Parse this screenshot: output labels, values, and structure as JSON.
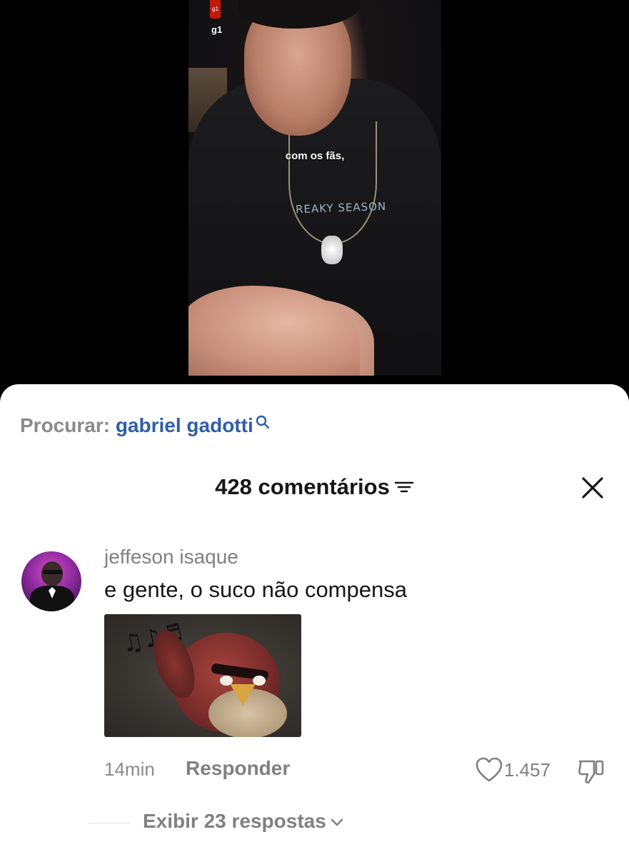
{
  "video": {
    "caption": "com os fãs,",
    "source_badge": "g1",
    "source_label": "g1",
    "shirt_print": "REAKY SEASON"
  },
  "search": {
    "prefix": "Procurar:",
    "term": "gabriel gadotti",
    "icon": "search-icon"
  },
  "comments_header": {
    "title": "428 comentários",
    "filter_icon": "filter-icon",
    "close_icon": "close-icon"
  },
  "comment": {
    "username": "jeffeson isaque",
    "text": "e gente, o suco não compensa",
    "time": "14min",
    "reply_label": "Responder",
    "likes": "1.457",
    "like_icon": "heart-icon",
    "dislike_icon": "thumbs-down-icon",
    "replies_label": "Exibir 23 respostas",
    "replies_icon": "chevron-down-icon"
  },
  "colors": {
    "link_blue": "#2f5ea8",
    "muted_gray": "#808085",
    "text_dark": "#161616",
    "sheet_bg": "#ffffff"
  }
}
